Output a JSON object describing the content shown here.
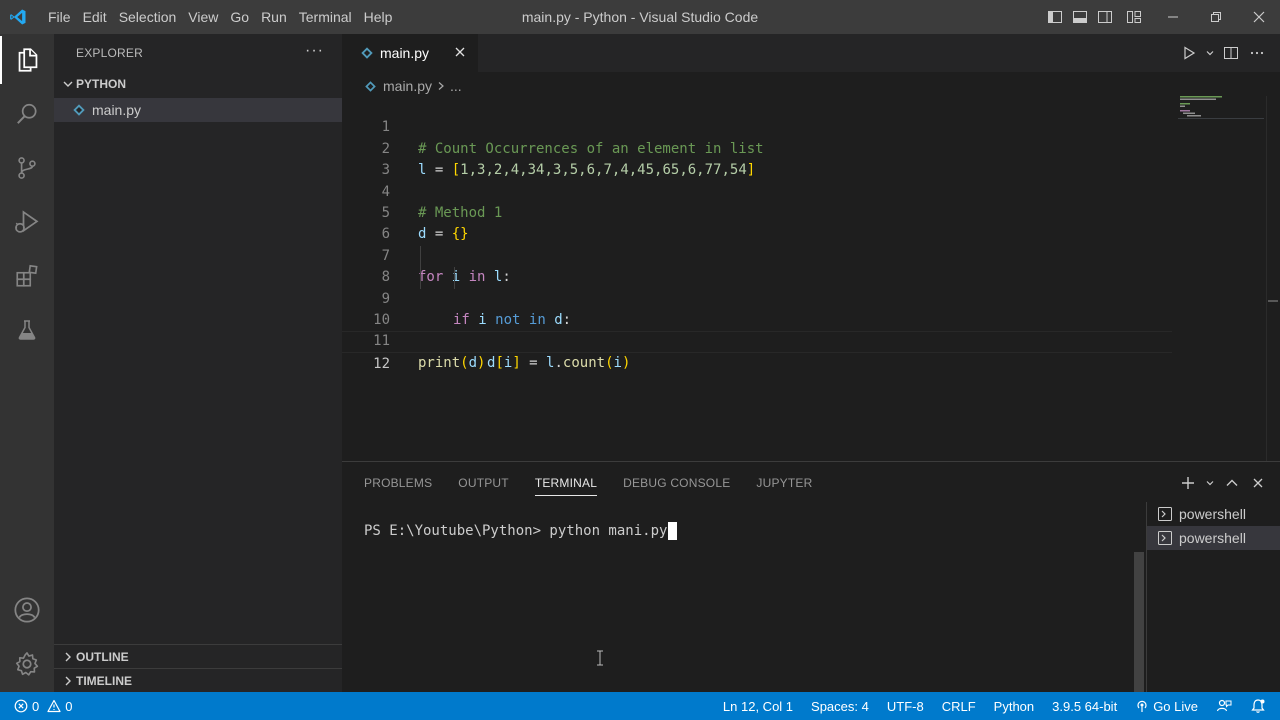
{
  "window": {
    "title": "main.py - Python - Visual Studio Code",
    "menu": [
      "File",
      "Edit",
      "Selection",
      "View",
      "Go",
      "Run",
      "Terminal",
      "Help"
    ]
  },
  "colors": {
    "accent": "#007acc",
    "titlebar": "#3c3c3c",
    "activitybar": "#333333",
    "sidebar": "#252526",
    "editor": "#1e1e1e"
  },
  "activity_bar": {
    "icons": [
      "explorer-icon",
      "search-icon",
      "source-control-icon",
      "run-debug-icon",
      "extensions-icon",
      "testing-icon",
      "account-icon",
      "manage-gear-icon"
    ]
  },
  "sidebar": {
    "title": "EXPLORER",
    "more": "···",
    "folder": "PYTHON",
    "file": "main.py",
    "outline": "OUTLINE",
    "timeline": "TIMELINE"
  },
  "editor": {
    "tab_label": "main.py",
    "breadcrumb_file": "main.py",
    "breadcrumb_rest": "...",
    "line_numbers": [
      "1",
      "2",
      "3",
      "4",
      "5",
      "6",
      "7",
      "8",
      "9",
      "10",
      "11",
      "12"
    ],
    "lines": {
      "l1": "# Count Occurrences of an element in list",
      "l2_var": "l",
      "l2_eq": " = ",
      "l2_open": "[",
      "l2_nums": "1,3,2,4,34,3,5,6,7,4,45,65,6,77,54",
      "l2_close": "]",
      "l4": "# Method 1",
      "l5_var": "d",
      "l5_eq": " = ",
      "l5_braces": "{}",
      "l7_for": "for",
      "l7_i": "i",
      "l7_in": "in",
      "l7_l": "l",
      "l7_colon": ":",
      "l8_if": "if",
      "l8_i": "i",
      "l8_not": "not",
      "l8_in": "in",
      "l8_d": "d",
      "l8_colon": ":",
      "l9_d": "d",
      "l9_b1": "[",
      "l9_i": "i",
      "l9_b2": "]",
      "l9_eq": " = ",
      "l9_l": "l",
      "l9_dot": ".",
      "l9_count": "count",
      "l9_p1": "(",
      "l9_i2": "i",
      "l9_p2": ")",
      "l11_print": "print",
      "l11_p1": "(",
      "l11_d": "d",
      "l11_p2": ")"
    }
  },
  "panel": {
    "tabs": [
      "PROBLEMS",
      "OUTPUT",
      "TERMINAL",
      "DEBUG CONSOLE",
      "JUPYTER"
    ],
    "active_tab": "TERMINAL",
    "terminal_text": "PS E:\\Youtube\\Python> python mani.py",
    "terminals": [
      "powershell",
      "powershell"
    ]
  },
  "status": {
    "errors": "0",
    "warnings": "0",
    "position": "Ln 12, Col 1",
    "spaces": "Spaces: 4",
    "encoding": "UTF-8",
    "eol": "CRLF",
    "language": "Python",
    "interpreter": "3.9.5 64-bit",
    "go_live": "Go Live"
  }
}
